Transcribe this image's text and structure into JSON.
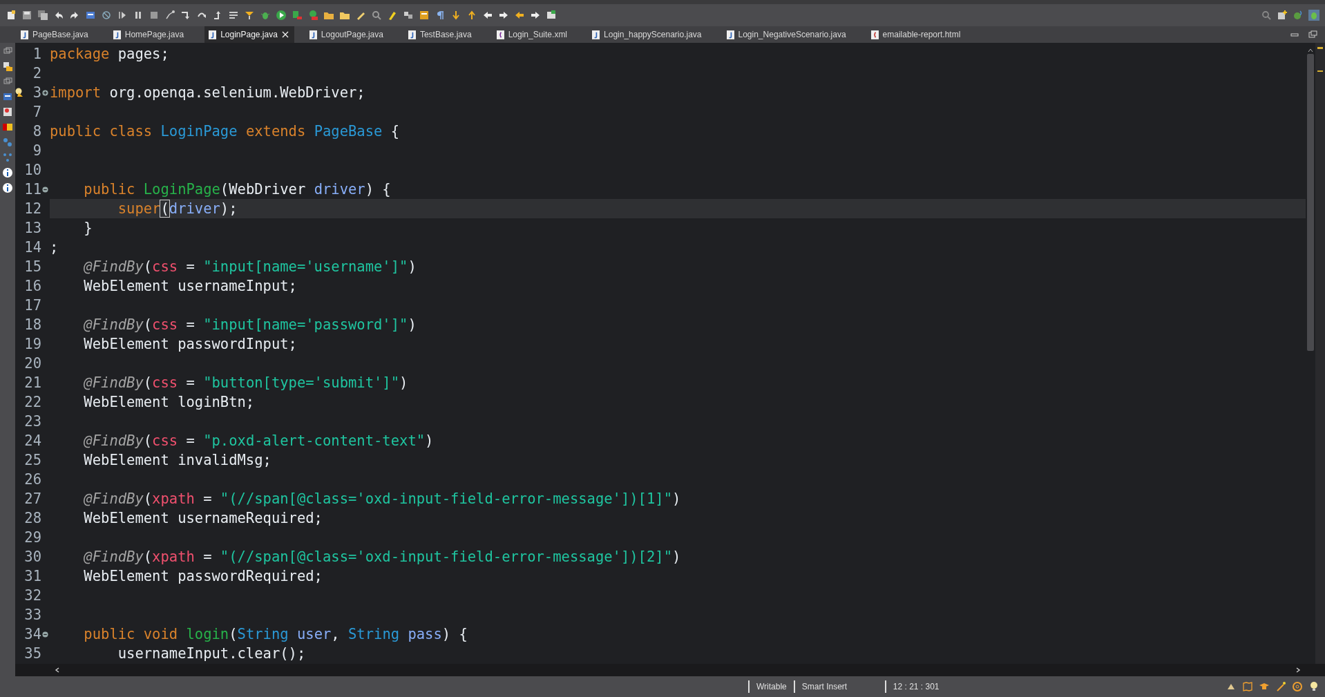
{
  "tabs": [
    {
      "label": "PageBase.java",
      "kind": "java",
      "selected": false
    },
    {
      "label": "HomePage.java",
      "kind": "java",
      "selected": false
    },
    {
      "label": "LoginPage.java",
      "kind": "java",
      "selected": true
    },
    {
      "label": "LogoutPage.java",
      "kind": "java",
      "selected": false
    },
    {
      "label": "TestBase.java",
      "kind": "java",
      "selected": false
    },
    {
      "label": "Login_Suite.xml",
      "kind": "xml",
      "selected": false
    },
    {
      "label": "Login_happyScenario.java",
      "kind": "java",
      "selected": false
    },
    {
      "label": "Login_NegativeScenario.java",
      "kind": "java",
      "selected": false
    },
    {
      "label": "emailable-report.html",
      "kind": "html",
      "selected": false
    }
  ],
  "editor": {
    "lines": [
      {
        "number": "1",
        "current": false,
        "tokens": [
          {
            "text": "package",
            "kind": "keyword"
          },
          {
            "text": " pages;",
            "kind": "plain"
          }
        ]
      },
      {
        "number": "2",
        "current": false
      },
      {
        "number": "3",
        "current": false,
        "collapsed": true,
        "warning": true,
        "tokens": [
          {
            "text": "import",
            "kind": "keyword"
          },
          {
            "text": " org.openqa.selenium.WebDriver;",
            "kind": "plain"
          }
        ]
      },
      {
        "number": "7",
        "current": false
      },
      {
        "number": "8",
        "current": false,
        "tokens": [
          {
            "text": "public class ",
            "kind": "keyword"
          },
          {
            "text": "LoginPage ",
            "kind": "type"
          },
          {
            "text": "extends ",
            "kind": "keyword"
          },
          {
            "text": "PageBase",
            "kind": "type"
          },
          {
            "text": " {",
            "kind": "plain"
          }
        ]
      },
      {
        "number": "9",
        "current": false
      },
      {
        "number": "10",
        "current": false
      },
      {
        "number": "11",
        "current": false,
        "collapsed": false,
        "tokens": [
          {
            "text": "    public ",
            "kind": "keyword"
          },
          {
            "text": "LoginPage",
            "kind": "method"
          },
          {
            "text": "(WebDriver ",
            "kind": "plain"
          },
          {
            "text": "driver",
            "kind": "param"
          },
          {
            "text": ") {",
            "kind": "plain"
          }
        ]
      },
      {
        "number": "12",
        "current": true,
        "tokens": [
          {
            "text": "        super",
            "kind": "keyword"
          },
          {
            "text": "(",
            "kind": "bracket-match"
          },
          {
            "text": "driver",
            "kind": "param"
          },
          {
            "text": ");",
            "kind": "plain"
          }
        ]
      },
      {
        "number": "13",
        "current": false,
        "tokens": [
          {
            "text": "    }",
            "kind": "plain"
          }
        ]
      },
      {
        "number": "14",
        "current": false,
        "tokens": [
          {
            "text": ";",
            "kind": "plain"
          }
        ]
      },
      {
        "number": "15",
        "current": false,
        "tokens": [
          {
            "text": "    @FindBy",
            "kind": "annotation"
          },
          {
            "text": "(",
            "kind": "plain"
          },
          {
            "text": "css",
            "kind": "attr"
          },
          {
            "text": " = ",
            "kind": "plain"
          },
          {
            "text": "\"input[name='username']\"",
            "kind": "string"
          },
          {
            "text": ")",
            "kind": "plain"
          }
        ]
      },
      {
        "number": "16",
        "current": false,
        "tokens": [
          {
            "text": "    WebElement usernameInput;",
            "kind": "plain"
          }
        ]
      },
      {
        "number": "17",
        "current": false
      },
      {
        "number": "18",
        "current": false,
        "tokens": [
          {
            "text": "    @FindBy",
            "kind": "annotation"
          },
          {
            "text": "(",
            "kind": "plain"
          },
          {
            "text": "css",
            "kind": "attr"
          },
          {
            "text": " = ",
            "kind": "plain"
          },
          {
            "text": "\"input[name='password']\"",
            "kind": "string"
          },
          {
            "text": ")",
            "kind": "plain"
          }
        ]
      },
      {
        "number": "19",
        "current": false,
        "tokens": [
          {
            "text": "    WebElement passwordInput;",
            "kind": "plain"
          }
        ]
      },
      {
        "number": "20",
        "current": false
      },
      {
        "number": "21",
        "current": false,
        "tokens": [
          {
            "text": "    @FindBy",
            "kind": "annotation"
          },
          {
            "text": "(",
            "kind": "plain"
          },
          {
            "text": "css",
            "kind": "attr"
          },
          {
            "text": " = ",
            "kind": "plain"
          },
          {
            "text": "\"button[type='submit']\"",
            "kind": "string"
          },
          {
            "text": ")",
            "kind": "plain"
          }
        ]
      },
      {
        "number": "22",
        "current": false,
        "tokens": [
          {
            "text": "    WebElement loginBtn;",
            "kind": "plain"
          }
        ]
      },
      {
        "number": "23",
        "current": false
      },
      {
        "number": "24",
        "current": false,
        "tokens": [
          {
            "text": "    @FindBy",
            "kind": "annotation"
          },
          {
            "text": "(",
            "kind": "plain"
          },
          {
            "text": "css",
            "kind": "attr"
          },
          {
            "text": " = ",
            "kind": "plain"
          },
          {
            "text": "\"p.oxd-alert-content-text\"",
            "kind": "string"
          },
          {
            "text": ")",
            "kind": "plain"
          }
        ]
      },
      {
        "number": "25",
        "current": false,
        "tokens": [
          {
            "text": "    WebElement invalidMsg;",
            "kind": "plain"
          }
        ]
      },
      {
        "number": "26",
        "current": false
      },
      {
        "number": "27",
        "current": false,
        "tokens": [
          {
            "text": "    @FindBy",
            "kind": "annotation"
          },
          {
            "text": "(",
            "kind": "plain"
          },
          {
            "text": "xpath",
            "kind": "attr"
          },
          {
            "text": " = ",
            "kind": "plain"
          },
          {
            "text": "\"(//span[@class='oxd-input-field-error-message'])[1]\"",
            "kind": "string"
          },
          {
            "text": ")",
            "kind": "plain"
          }
        ]
      },
      {
        "number": "28",
        "current": false,
        "tokens": [
          {
            "text": "    WebElement usernameRequired;",
            "kind": "plain"
          }
        ]
      },
      {
        "number": "29",
        "current": false
      },
      {
        "number": "30",
        "current": false,
        "tokens": [
          {
            "text": "    @FindBy",
            "kind": "annotation"
          },
          {
            "text": "(",
            "kind": "plain"
          },
          {
            "text": "xpath",
            "kind": "attr"
          },
          {
            "text": " = ",
            "kind": "plain"
          },
          {
            "text": "\"(//span[@class='oxd-input-field-error-message'])[2]\"",
            "kind": "string"
          },
          {
            "text": ")",
            "kind": "plain"
          }
        ]
      },
      {
        "number": "31",
        "current": false,
        "tokens": [
          {
            "text": "    WebElement passwordRequired;",
            "kind": "plain"
          }
        ]
      },
      {
        "number": "32",
        "current": false
      },
      {
        "number": "33",
        "current": false
      },
      {
        "number": "34",
        "current": false,
        "collapsed": false,
        "tokens": [
          {
            "text": "    public void ",
            "kind": "keyword"
          },
          {
            "text": "login",
            "kind": "method"
          },
          {
            "text": "(",
            "kind": "plain"
          },
          {
            "text": "String ",
            "kind": "type"
          },
          {
            "text": "user",
            "kind": "param"
          },
          {
            "text": ", ",
            "kind": "plain"
          },
          {
            "text": "String ",
            "kind": "type"
          },
          {
            "text": "pass",
            "kind": "param"
          },
          {
            "text": ") {",
            "kind": "plain"
          }
        ]
      },
      {
        "number": "35",
        "current": false,
        "tokens": [
          {
            "text": "        usernameInput.clear();",
            "kind": "plain"
          }
        ]
      }
    ]
  },
  "status_bar": {
    "mode": "Writable",
    "insert_mode": "Smart Insert",
    "position": "12 : 21 : 301"
  }
}
